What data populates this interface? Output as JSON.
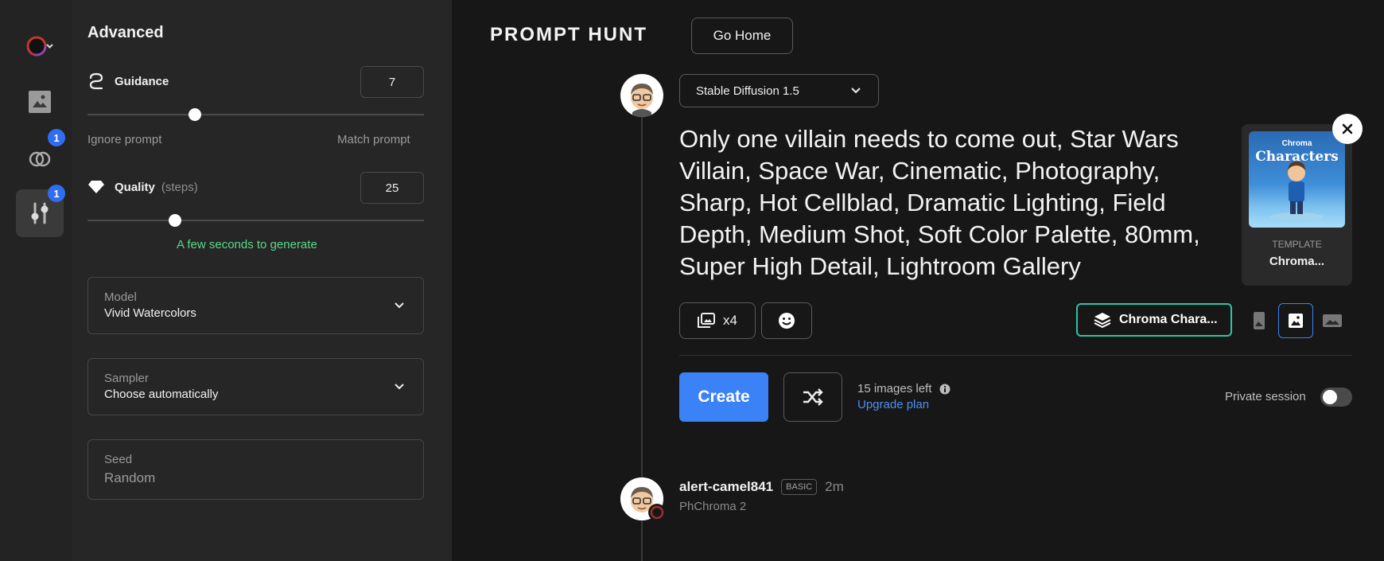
{
  "sidebar": {
    "rail": [
      {
        "icon": "color-ring-icon"
      },
      {
        "icon": "image-icon"
      },
      {
        "icon": "overlap-circles-icon",
        "badge": "1"
      },
      {
        "icon": "sliders-icon",
        "badge": "1",
        "active": true
      }
    ]
  },
  "advanced": {
    "title": "Advanced",
    "guidance": {
      "label": "Guidance",
      "value": "7",
      "value_fraction": 0.32,
      "min_label": "Ignore prompt",
      "max_label": "Match prompt"
    },
    "quality": {
      "label": "Quality",
      "sublabel": "(steps)",
      "value": "25",
      "value_fraction": 0.26,
      "hint": "A few seconds to generate"
    },
    "model": {
      "label": "Model",
      "value": "Vivid Watercolors"
    },
    "sampler": {
      "label": "Sampler",
      "value": "Choose automatically"
    },
    "seed": {
      "label": "Seed",
      "placeholder": "Random"
    }
  },
  "header": {
    "logo": "PROMPT HUNT",
    "go_home": "Go Home"
  },
  "composer": {
    "model_select": "Stable Diffusion 1.5",
    "prompt": "Only one villain needs to come out,  Star Wars Villain, Space War, Cinematic, Photography, Sharp, Hot Cellblad, Dramatic Lighting, Field Depth, Medium Shot, Soft Color Palette, 80mm, Super High Detail, Lightroom Gallery",
    "count_label": "x4",
    "template": {
      "image_title_top": "Chroma",
      "image_title_main": "Characters",
      "kind": "TEMPLATE",
      "name": "Chroma..."
    },
    "template_chip": "Chroma Chara...",
    "create_label": "Create",
    "images_left": "15 images left",
    "upgrade": "Upgrade plan",
    "private_label": "Private session"
  },
  "feed": {
    "user": "alert-camel841",
    "plan": "BASIC",
    "time": "2m",
    "subtitle": "PhChroma 2"
  },
  "colors": {
    "accent": "#3b82f6",
    "teal": "#2ec4a6",
    "success": "#58d98a",
    "badge": "#2f6ef0"
  }
}
